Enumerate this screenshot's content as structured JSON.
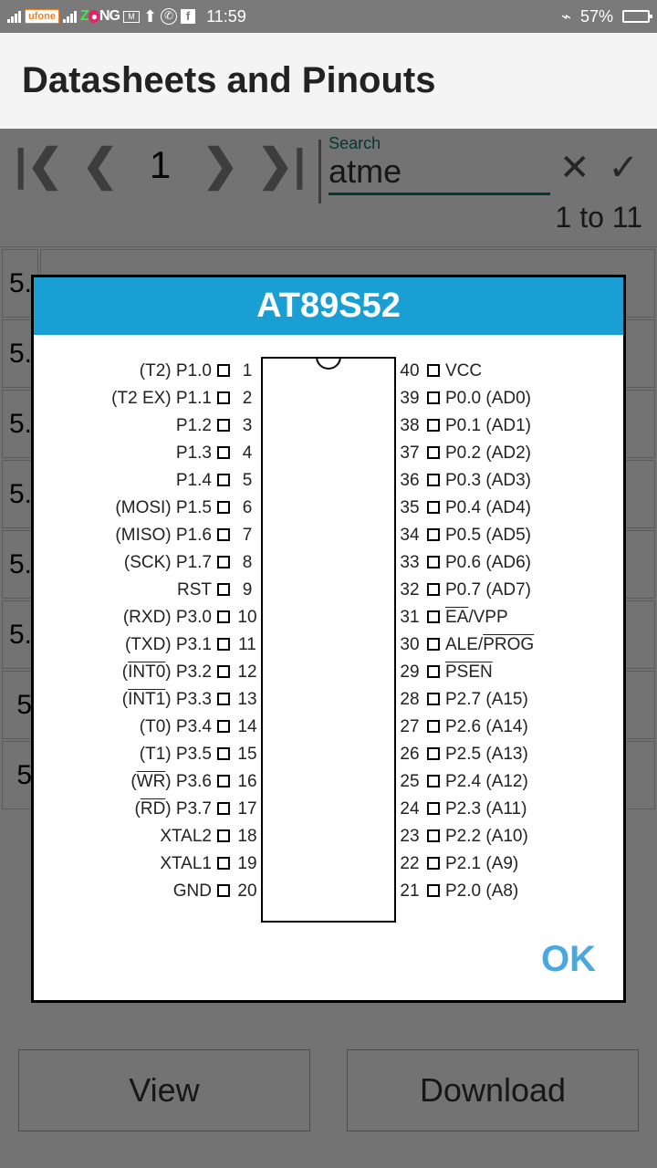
{
  "status_bar": {
    "carrier1": "ufone",
    "carrier2_z": "Z",
    "carrier2_ng": "NG",
    "time": "11:59",
    "battery_pct": "57%"
  },
  "app": {
    "title": "Datasheets and Pinouts"
  },
  "toolbar": {
    "page": "1",
    "search_label": "Search",
    "search_value": "atme",
    "results": "1 to 11"
  },
  "bg_rows": [
    "5.",
    "5.",
    "5.",
    "5.",
    "5.",
    "5.",
    "5",
    "5"
  ],
  "buttons": {
    "view": "View",
    "download": "Download"
  },
  "dialog": {
    "title": "AT89S52",
    "ok": "OK",
    "pins_left": [
      {
        "label": "(T2) P1.0",
        "num": "1"
      },
      {
        "label": "(T2 EX) P1.1",
        "num": "2"
      },
      {
        "label": "P1.2",
        "num": "3"
      },
      {
        "label": "P1.3",
        "num": "4"
      },
      {
        "label": "P1.4",
        "num": "5"
      },
      {
        "label": "(MOSI) P1.5",
        "num": "6"
      },
      {
        "label": "(MISO) P1.6",
        "num": "7"
      },
      {
        "label": "(SCK) P1.7",
        "num": "8"
      },
      {
        "label": "RST",
        "num": "9"
      },
      {
        "label": "(RXD) P3.0",
        "num": "10"
      },
      {
        "label": "(TXD) P3.1",
        "num": "11"
      },
      {
        "label_pre": "(",
        "label_over": "INT0",
        "label_post": ") P3.2",
        "num": "12"
      },
      {
        "label_pre": "(",
        "label_over": "INT1",
        "label_post": ") P3.3",
        "num": "13"
      },
      {
        "label": "(T0) P3.4",
        "num": "14"
      },
      {
        "label": "(T1) P3.5",
        "num": "15"
      },
      {
        "label_pre": "(",
        "label_over": "WR",
        "label_post": ") P3.6",
        "num": "16"
      },
      {
        "label_pre": "(",
        "label_over": "RD",
        "label_post": ") P3.7",
        "num": "17"
      },
      {
        "label": "XTAL2",
        "num": "18"
      },
      {
        "label": "XTAL1",
        "num": "19"
      },
      {
        "label": "GND",
        "num": "20"
      }
    ],
    "pins_right": [
      {
        "num": "40",
        "label": "VCC"
      },
      {
        "num": "39",
        "label": "P0.0 (AD0)"
      },
      {
        "num": "38",
        "label": "P0.1 (AD1)"
      },
      {
        "num": "37",
        "label": "P0.2 (AD2)"
      },
      {
        "num": "36",
        "label": "P0.3 (AD3)"
      },
      {
        "num": "35",
        "label": "P0.4 (AD4)"
      },
      {
        "num": "34",
        "label": "P0.5 (AD5)"
      },
      {
        "num": "33",
        "label": "P0.6 (AD6)"
      },
      {
        "num": "32",
        "label": "P0.7 (AD7)"
      },
      {
        "num": "31",
        "label_over": "EA",
        "label_post": "/VPP"
      },
      {
        "num": "30",
        "label_pre": "ALE/",
        "label_over": "PROG"
      },
      {
        "num": "29",
        "label_over": "PSEN"
      },
      {
        "num": "28",
        "label": "P2.7 (A15)"
      },
      {
        "num": "27",
        "label": "P2.6 (A14)"
      },
      {
        "num": "26",
        "label": "P2.5 (A13)"
      },
      {
        "num": "25",
        "label": "P2.4 (A12)"
      },
      {
        "num": "24",
        "label": "P2.3 (A11)"
      },
      {
        "num": "23",
        "label": "P2.2 (A10)"
      },
      {
        "num": "22",
        "label": "P2.1 (A9)"
      },
      {
        "num": "21",
        "label": "P2.0 (A8)"
      }
    ]
  }
}
